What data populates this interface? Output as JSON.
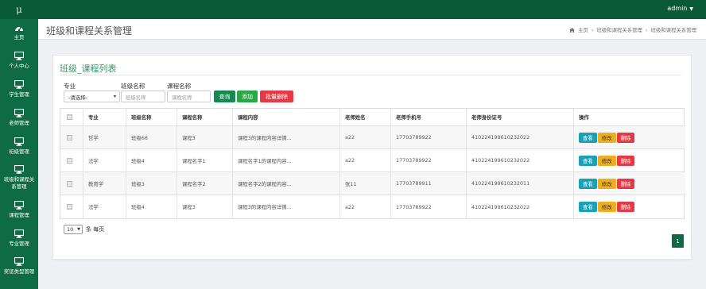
{
  "app": {
    "logo": "μ",
    "user": "admin"
  },
  "sidebar": {
    "items": [
      {
        "label": "主页",
        "icon": "dashboard-icon"
      },
      {
        "label": "个人中心",
        "icon": "monitor-icon"
      },
      {
        "label": "学生管理",
        "icon": "monitor-icon"
      },
      {
        "label": "老师管理",
        "icon": "monitor-icon"
      },
      {
        "label": "班级管理",
        "icon": "monitor-icon"
      },
      {
        "label": "班级和课程关系管理",
        "icon": "monitor-icon"
      },
      {
        "label": "课程管理",
        "icon": "monitor-icon"
      },
      {
        "label": "专业管理",
        "icon": "monitor-icon"
      },
      {
        "label": "奖惩类型管理",
        "icon": "monitor-icon"
      }
    ]
  },
  "header": {
    "title": "班级和课程关系管理",
    "breadcrumb": [
      "主页",
      "班级和课程关系管理",
      "班级和课程关系管理"
    ]
  },
  "panel": {
    "title": "班级_课程列表",
    "filters": {
      "major_label": "专业",
      "major_value": "-请选择-",
      "class_label": "班级名称",
      "class_placeholder": "班级名称",
      "course_label": "课程名称",
      "course_placeholder": "课程名称"
    },
    "buttons": {
      "search": "查询",
      "add": "添加",
      "bulk_delete": "批量删除"
    }
  },
  "table": {
    "columns": [
      "专业",
      "班级名称",
      "课程名称",
      "课程内容",
      "老师姓名",
      "老师手机号",
      "老师身份证号",
      "操作"
    ],
    "rows": [
      [
        "哲学",
        "班级66",
        "课程3",
        "课程3的课程内容详情...",
        "a22",
        "17703789922",
        "410224199610232022"
      ],
      [
        "法学",
        "班级4",
        "课程名字1",
        "课程名字1的课程内容...",
        "a22",
        "17703789922",
        "410224199610232022"
      ],
      [
        "教育学",
        "班级3",
        "课程名字2",
        "课程名字2的课程内容...",
        "张11",
        "17703789911",
        "410224199610232011"
      ],
      [
        "法学",
        "班级4",
        "课程3",
        "课程3的课程内容详情...",
        "a22",
        "17703789922",
        "410224199610232022"
      ]
    ],
    "actions": {
      "view": "查看",
      "edit": "修改",
      "delete": "删除"
    }
  },
  "pagination": {
    "page_size": "10",
    "page_size_suffix": "条 每页",
    "current_page": "1"
  },
  "colors": {
    "topbar": "#0b5a37",
    "sidebar": "#0e6b43",
    "accent": "#2f9a63",
    "view": "#17a2b8",
    "edit": "#f0ad1e",
    "delete": "#e63946"
  }
}
